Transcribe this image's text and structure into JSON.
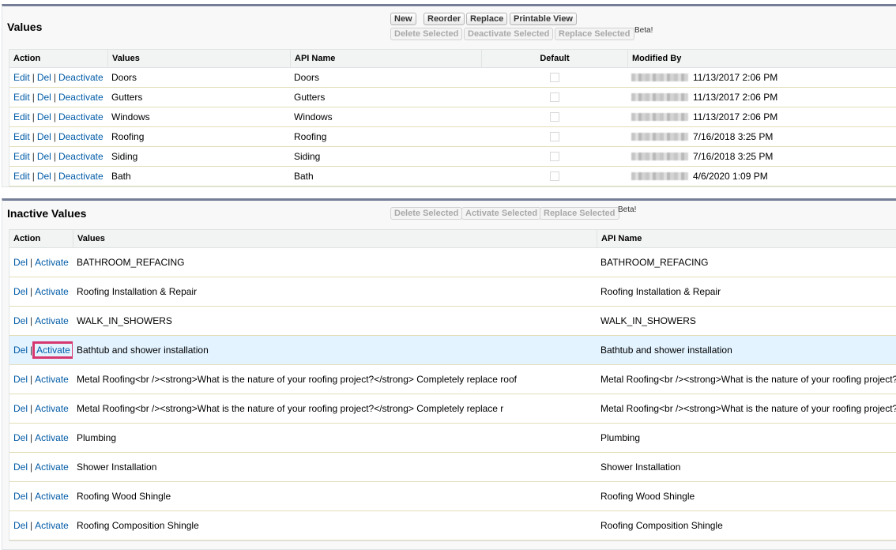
{
  "active": {
    "title": "Values",
    "buttons": {
      "new": "New",
      "reorder": "Reorder",
      "replace": "Replace",
      "printable_view": "Printable View"
    },
    "bulk_buttons": {
      "delete_selected": "Delete Selected",
      "deactivate_selected": "Deactivate Selected",
      "replace_selected": "Replace Selected"
    },
    "beta": "Beta!",
    "columns": {
      "action": "Action",
      "values": "Values",
      "api_name": "API Name",
      "default": "Default",
      "modified_by": "Modified By"
    },
    "action_labels": {
      "edit": "Edit",
      "del": "Del",
      "deactivate": "Deactivate",
      "separator": "|"
    },
    "rows": [
      {
        "value": "Doors",
        "api_name": "Doors",
        "default": false,
        "modified_date": "11/13/2017 2:06 PM"
      },
      {
        "value": "Gutters",
        "api_name": "Gutters",
        "default": false,
        "modified_date": "11/13/2017 2:06 PM"
      },
      {
        "value": "Windows",
        "api_name": "Windows",
        "default": false,
        "modified_date": "11/13/2017 2:06 PM"
      },
      {
        "value": "Roofing",
        "api_name": "Roofing",
        "default": false,
        "modified_date": "7/16/2018 3:25 PM"
      },
      {
        "value": "Siding",
        "api_name": "Siding",
        "default": false,
        "modified_date": "7/16/2018 3:25 PM"
      },
      {
        "value": "Bath",
        "api_name": "Bath",
        "default": false,
        "modified_date": "4/6/2020 1:09 PM"
      }
    ]
  },
  "inactive": {
    "title": "Inactive Values",
    "bulk_buttons": {
      "delete_selected": "Delete Selected",
      "activate_selected": "Activate Selected",
      "replace_selected": "Replace Selected"
    },
    "beta": "Beta!",
    "columns": {
      "action": "Action",
      "values": "Values",
      "api_name": "API Name"
    },
    "action_labels": {
      "del": "Del",
      "activate": "Activate",
      "separator": "|"
    },
    "highlighted_row_index": 3,
    "rows": [
      {
        "value": "BATHROOM_REFACING",
        "api_name": "BATHROOM_REFACING"
      },
      {
        "value": "Roofing Installation & Repair",
        "api_name": "Roofing Installation & Repair"
      },
      {
        "value": "WALK_IN_SHOWERS",
        "api_name": "WALK_IN_SHOWERS"
      },
      {
        "value": "Bathtub and shower installation",
        "api_name": "Bathtub and shower installation"
      },
      {
        "value": "Metal Roofing<br /><strong>What is the nature of your roofing project?</strong> Completely replace roof",
        "api_name": "Metal Roofing<br /><strong>What is the nature of your roofing project?</strong> Completely replace roof"
      },
      {
        "value": "Metal Roofing<br /><strong>What is the nature of your roofing project?</strong> Completely replace r",
        "api_name": "Metal Roofing<br /><strong>What is the nature of your roofing project?</strong> Completely replace r"
      },
      {
        "value": "Plumbing",
        "api_name": "Plumbing"
      },
      {
        "value": "Shower Installation",
        "api_name": "Shower Installation"
      },
      {
        "value": "Roofing Wood Shingle",
        "api_name": "Roofing Wood Shingle"
      },
      {
        "value": "Roofing Composition Shingle",
        "api_name": "Roofing Composition Shingle"
      }
    ]
  },
  "colors": {
    "link": "#015ba7",
    "highlight_row": "#e3f3ff",
    "focus_outline": "#d7376f",
    "panel_border": "#747e96"
  }
}
